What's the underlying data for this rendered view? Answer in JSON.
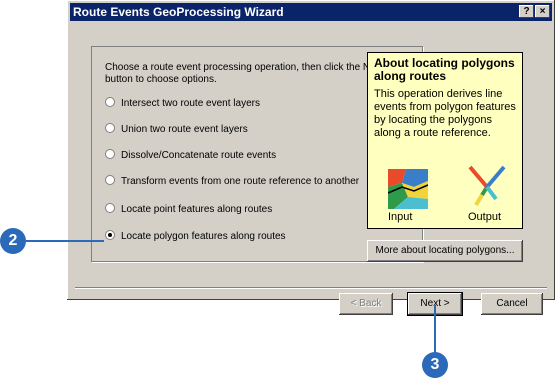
{
  "window": {
    "title": "Route Events GeoProcessing Wizard",
    "help_btn": "?",
    "close_btn": "×"
  },
  "instructions": "Choose a route event processing operation, then click the Next button to choose options.",
  "options": [
    {
      "label": "Intersect two route event layers",
      "selected": false
    },
    {
      "label": "Union two route event layers",
      "selected": false
    },
    {
      "label": "Dissolve/Concatenate route events",
      "selected": false
    },
    {
      "label": "Transform events from one route reference to another",
      "selected": false
    },
    {
      "label": "Locate point features along routes",
      "selected": false
    },
    {
      "label": "Locate polygon features along routes",
      "selected": true
    }
  ],
  "help": {
    "title": "About locating polygons along routes",
    "body": "This operation derives line events from polygon features by locating the polygons along a route reference.",
    "input_caption": "Input",
    "output_caption": "Output",
    "input_icon": "polygon-map-icon",
    "output_icon": "route-lines-icon"
  },
  "more_button": "More about locating polygons...",
  "buttons": {
    "back": "< Back",
    "next": "Next >",
    "cancel": "Cancel"
  },
  "callouts": {
    "step2": "2",
    "step3": "3"
  },
  "colors": {
    "titlebar": "#0a246a",
    "dialog": "#d4d0c8",
    "help_bg": "#ffffc0",
    "callout": "#2a6ab8"
  }
}
